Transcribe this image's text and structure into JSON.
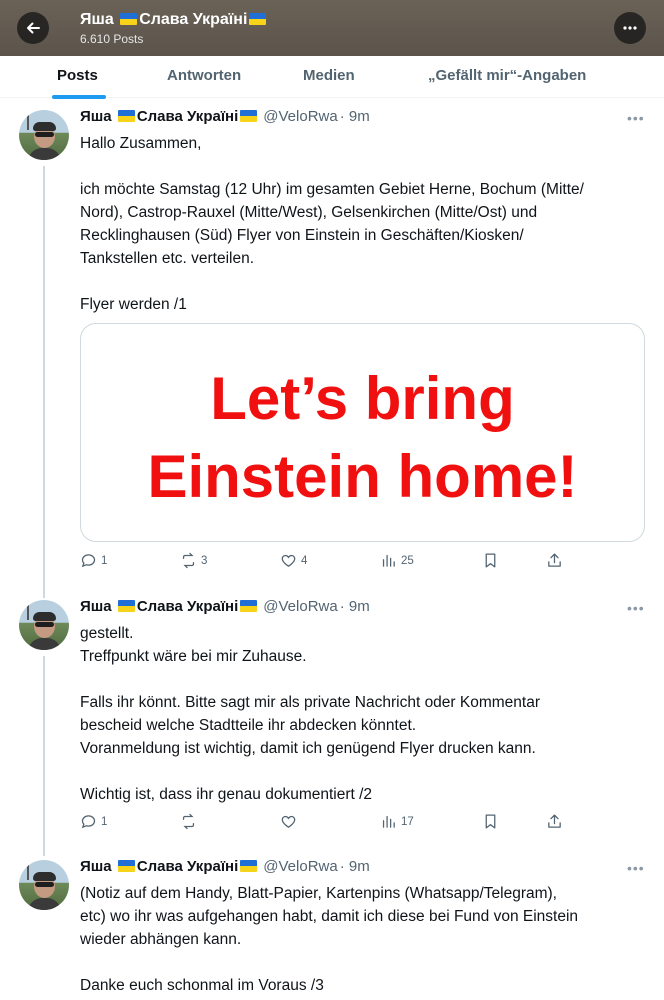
{
  "header": {
    "name_prefix": "Яша",
    "name_suffix": "Слава Україні",
    "posts_count": "6.610 Posts"
  },
  "tabs": [
    {
      "label": "Posts",
      "active": true
    },
    {
      "label": "Antworten",
      "active": false
    },
    {
      "label": "Medien",
      "active": false
    },
    {
      "label": "„Gefällt mir“-Angaben",
      "active": false
    }
  ],
  "colors": {
    "accent": "#1d9bf0",
    "header_bg": "#6b6257",
    "media_text": "#f01010",
    "flag_blue": "#1f6fd6",
    "flag_yellow": "#f7d31a"
  },
  "posts": [
    {
      "name_prefix": "Яша",
      "name_suffix": "Слава Україні",
      "handle": "@VeloRwa",
      "time": "· 9m",
      "lines": [
        "Hallo Zusammen,",
        "",
        "ich möchte Samstag (12 Uhr) im gesamten Gebiet Herne, Bochum (Mitte/",
        "Nord), Castrop-Rauxel (Mitte/West), Gelsenkirchen (Mitte/Ost) und",
        "Recklinghausen (Süd) Flyer von Einstein in Geschäften/Kiosken/",
        "Tankstellen etc. verteilen.",
        "",
        "Flyer werden /1"
      ],
      "media": {
        "line1": "Let’s bring",
        "line2": "Einstein home!"
      },
      "replies": "1",
      "reposts": "3",
      "likes": "4",
      "views": "25"
    },
    {
      "name_prefix": "Яша",
      "name_suffix": "Слава Україні",
      "handle": "@VeloRwa",
      "time": "· 9m",
      "lines": [
        "gestellt.",
        "Treffpunkt wäre bei mir Zuhause.",
        "",
        "Falls ihr könnt. Bitte sagt mir als private Nachricht oder Kommentar",
        "bescheid welche Stadtteile ihr abdecken könntet.",
        "Voranmeldung ist wichtig, damit ich genügend Flyer drucken kann.",
        "",
        "Wichtig ist, dass ihr genau dokumentiert /2"
      ],
      "replies": "1",
      "reposts": "",
      "likes": "",
      "views": "17"
    },
    {
      "name_prefix": "Яша",
      "name_suffix": "Слава Україні",
      "handle": "@VeloRwa",
      "time": "· 9m",
      "lines": [
        "(Notiz auf dem Handy, Blatt-Papier, Kartenpins (Whatsapp/Telegram),",
        "etc) wo ihr was aufgehangen habt, damit ich diese bei Fund von Einstein",
        "wieder abhängen kann.",
        "",
        "Danke euch schonmal im Voraus /3"
      ]
    }
  ]
}
